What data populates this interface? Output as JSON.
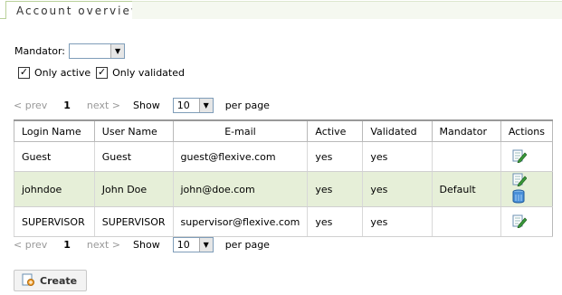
{
  "tab": {
    "title": "Account overview"
  },
  "filters": {
    "mandator_label": "Mandator:",
    "mandator_value": "",
    "only_active_label": "Only active",
    "only_active_checked": "✓",
    "only_validated_label": "Only validated",
    "only_validated_checked": "✓"
  },
  "pager": {
    "prev": "< prev",
    "page": "1",
    "next": "next >",
    "show": "Show",
    "page_size": "10",
    "per_page": "per page"
  },
  "table": {
    "headers": [
      "Login Name",
      "User Name",
      "E-mail",
      "Active",
      "Validated",
      "Mandator",
      "Actions"
    ],
    "rows": [
      {
        "login": "Guest",
        "user": "Guest",
        "email": "guest@flexive.com",
        "active": "yes",
        "validated": "yes",
        "mandator": ""
      },
      {
        "login": "johndoe",
        "user": "John Doe",
        "email": "john@doe.com",
        "active": "yes",
        "validated": "yes",
        "mandator": "Default"
      },
      {
        "login": "SUPERVISOR",
        "user": "SUPERVISOR",
        "email": "supervisor@flexive.com",
        "active": "yes",
        "validated": "yes",
        "mandator": ""
      }
    ]
  },
  "actions": {
    "create_label": "Create"
  },
  "colors": {
    "accent_green": "#b9d19a",
    "row_highlight": "#e6efd8"
  }
}
